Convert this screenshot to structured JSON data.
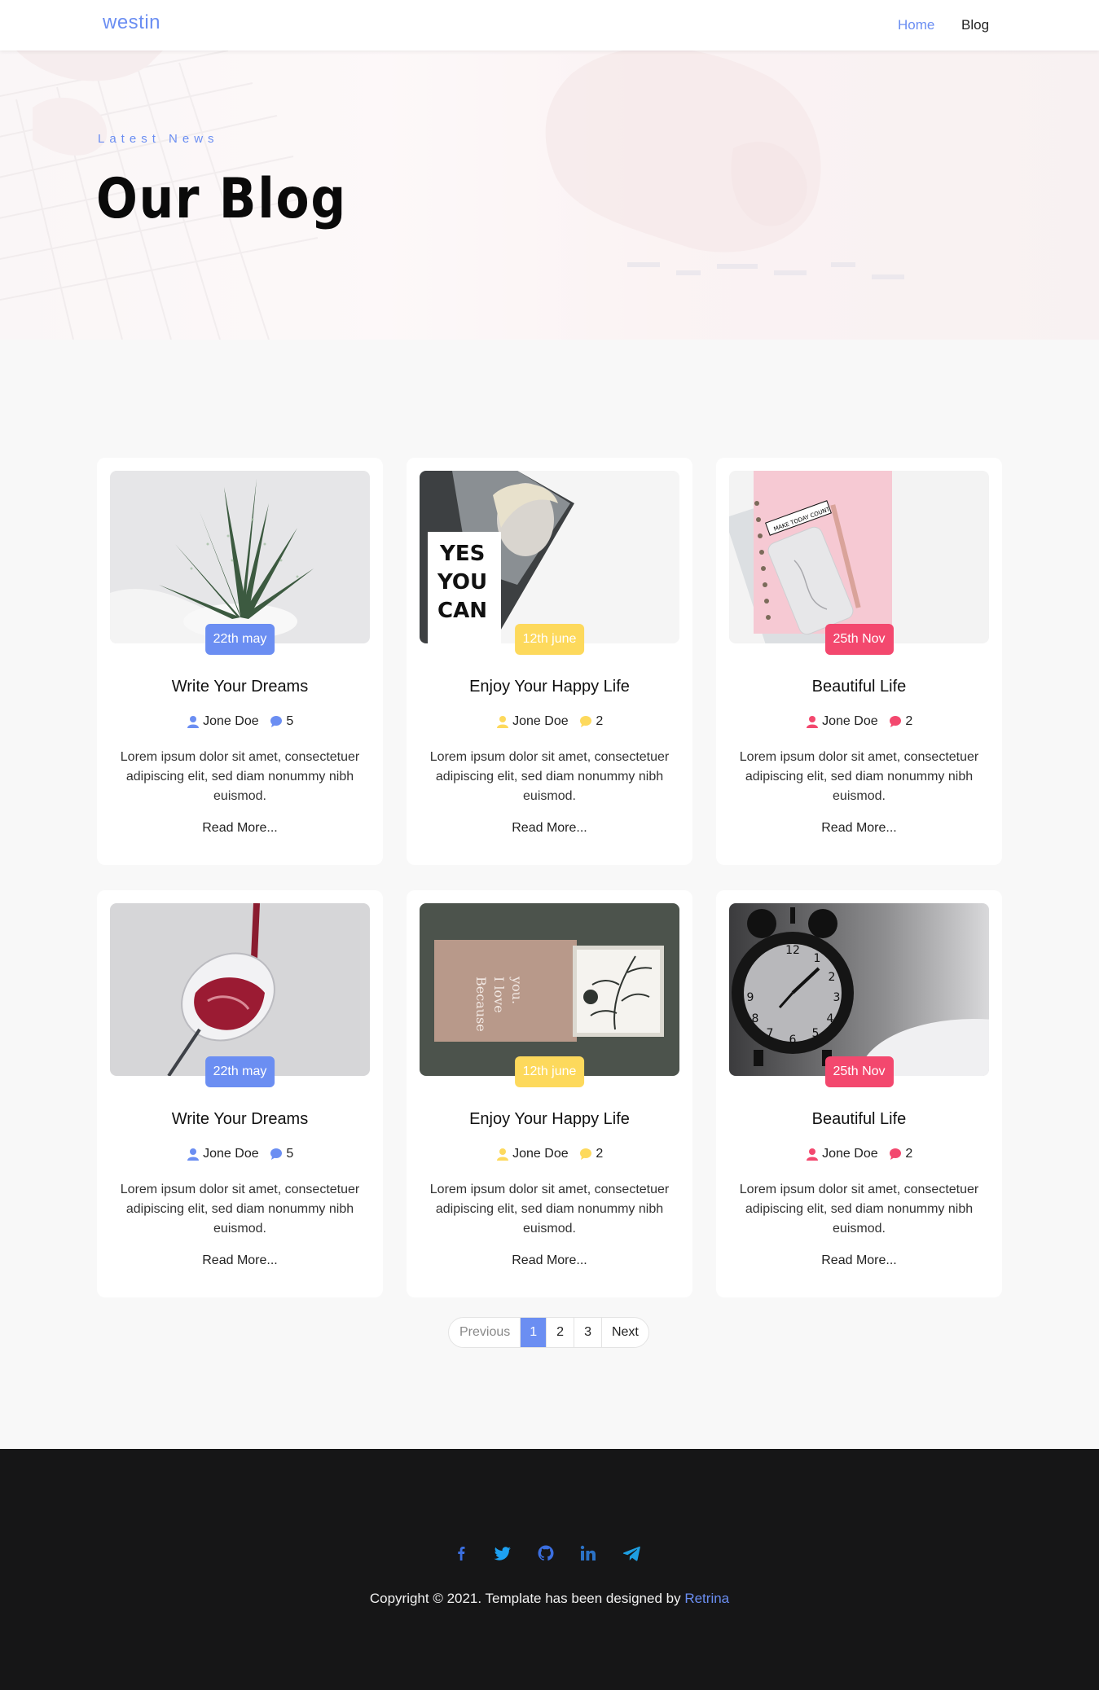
{
  "nav": {
    "brand": "westin",
    "links": [
      "Home",
      "Blog"
    ]
  },
  "hero": {
    "subtitle": "Latest News",
    "title": "Our Blog"
  },
  "colors": {
    "blue": "#6b8ef2",
    "yellow": "#fdd95c",
    "pink": "#f3486e"
  },
  "posts": [
    {
      "date": "22th may",
      "title": "Write Your Dreams",
      "author": "Jone Doe",
      "comments": "5",
      "excerpt": "Lorem ipsum dolor sit amet, consectetuer adipiscing elit, sed diam nonummy nibh euismod.",
      "read_more": "Read More...",
      "image": "aloe-plant"
    },
    {
      "date": "12th june",
      "title": "Enjoy Your Happy Life",
      "author": "Jone Doe",
      "comments": "2",
      "excerpt": "Lorem ipsum dolor sit amet, consectetuer adipiscing elit, sed diam nonummy nibh euismod.",
      "read_more": "Read More...",
      "image": "yes-you-can-magazine"
    },
    {
      "date": "25th Nov",
      "title": "Beautiful Life",
      "author": "Jone Doe",
      "comments": "2",
      "excerpt": "Lorem ipsum dolor sit amet, consectetuer adipiscing elit, sed diam nonummy nibh euismod.",
      "read_more": "Read More...",
      "image": "pink-notebook-phone"
    },
    {
      "date": "22th may",
      "title": "Write Your Dreams",
      "author": "Jone Doe",
      "comments": "5",
      "excerpt": "Lorem ipsum dolor sit amet, consectetuer adipiscing elit, sed diam nonummy nibh euismod.",
      "read_more": "Read More...",
      "image": "wine-glass"
    },
    {
      "date": "12th june",
      "title": "Enjoy Your Happy Life",
      "author": "Jone Doe",
      "comments": "2",
      "excerpt": "Lorem ipsum dolor sit amet, consectetuer adipiscing elit, sed diam nonummy nibh euismod.",
      "read_more": "Read More...",
      "image": "gift-box"
    },
    {
      "date": "25th Nov",
      "title": "Beautiful Life",
      "author": "Jone Doe",
      "comments": "2",
      "excerpt": "Lorem ipsum dolor sit amet, consectetuer adipiscing elit, sed diam nonummy nibh euismod.",
      "read_more": "Read More...",
      "image": "alarm-clock"
    }
  ],
  "pagination": {
    "previous": "Previous",
    "pages": [
      "1",
      "2",
      "3"
    ],
    "next": "Next",
    "current": "1"
  },
  "image_text": {
    "magazine": [
      "YES",
      "YOU",
      "CAN"
    ],
    "notebook": "MAKE TODAY COUNT",
    "box": [
      "Because",
      "I love",
      "you."
    ]
  },
  "footer": {
    "social": [
      "facebook-icon",
      "twitter-icon",
      "github-icon",
      "linkedin-icon",
      "telegram-icon"
    ],
    "copyright": "Copyright © 2021. Template has been designed by",
    "designer": "Retrina"
  }
}
